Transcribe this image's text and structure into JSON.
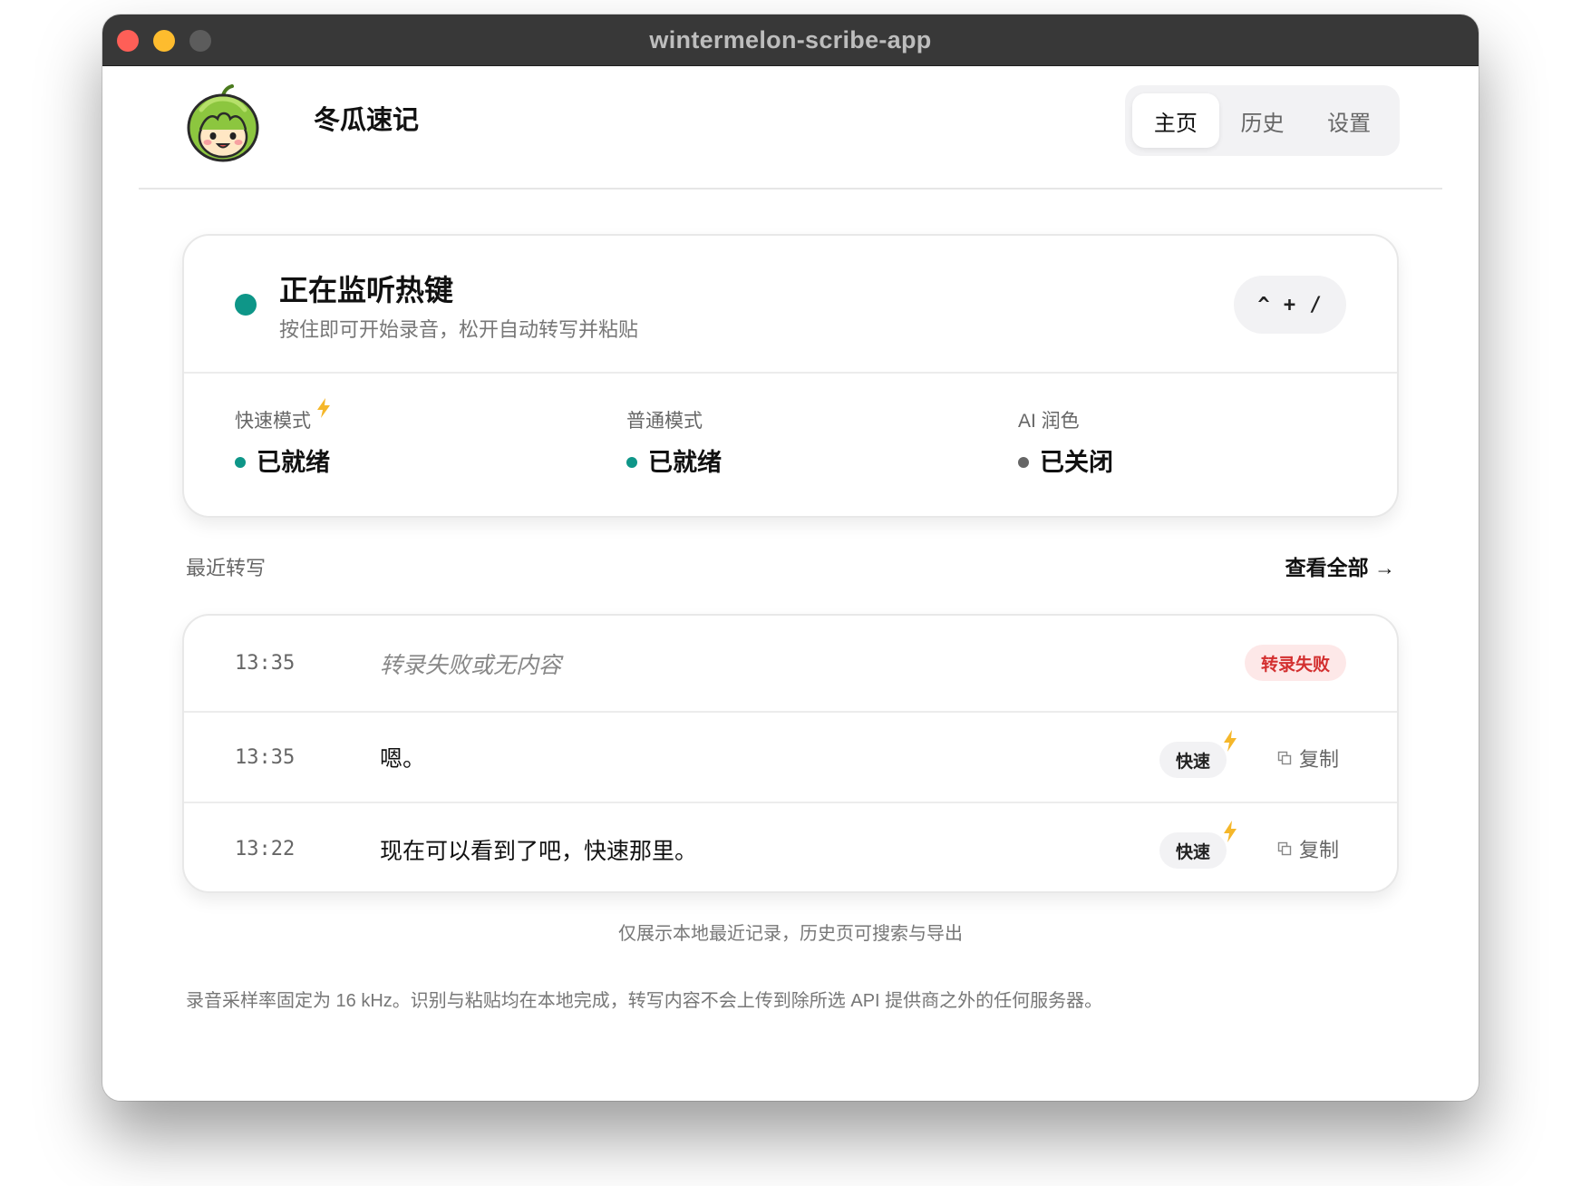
{
  "window": {
    "title": "wintermelon-scribe-app"
  },
  "header": {
    "app_name": "冬瓜速记",
    "tabs": [
      {
        "label": "主页",
        "active": true
      },
      {
        "label": "历史",
        "active": false
      },
      {
        "label": "设置",
        "active": false
      }
    ]
  },
  "status": {
    "title": "正在监听热键",
    "subtitle": "按住即可开始录音，松开自动转写并粘贴",
    "hotkey": "^ + /",
    "indicator_color": "#0e9688",
    "modes": [
      {
        "label": "快速模式",
        "value": "已就绪",
        "state_color": "#0e9688",
        "has_bolt_icon": true
      },
      {
        "label": "普通模式",
        "value": "已就绪",
        "state_color": "#0e9688",
        "has_bolt_icon": false
      },
      {
        "label": "AI 润色",
        "value": "已关闭",
        "state_color": "#666666",
        "has_bolt_icon": false
      }
    ]
  },
  "recent": {
    "section_title": "最近转写",
    "view_all": "查看全部 →",
    "items": [
      {
        "time": "13:35",
        "text": "转录失败或无内容",
        "status": "failed",
        "badge": "转录失败"
      },
      {
        "time": "13:35",
        "text": "嗯。",
        "status": "ok",
        "badge": "快速",
        "copy_label": "复制"
      },
      {
        "time": "13:22",
        "text": "现在可以看到了吧，快速那里。",
        "status": "ok",
        "badge": "快速",
        "copy_label": "复制"
      }
    ]
  },
  "footer": {
    "local_note": "仅展示本地最近记录，历史页可搜索与导出",
    "privacy_note": "录音采样率固定为 16 kHz。识别与粘贴均在本地完成，转写内容不会上传到除所选 API 提供商之外的任何服务器。"
  },
  "colors": {
    "accent_teal": "#0e9688",
    "bolt_yellow": "#f5b72a",
    "error_red": "#d32f2f"
  }
}
